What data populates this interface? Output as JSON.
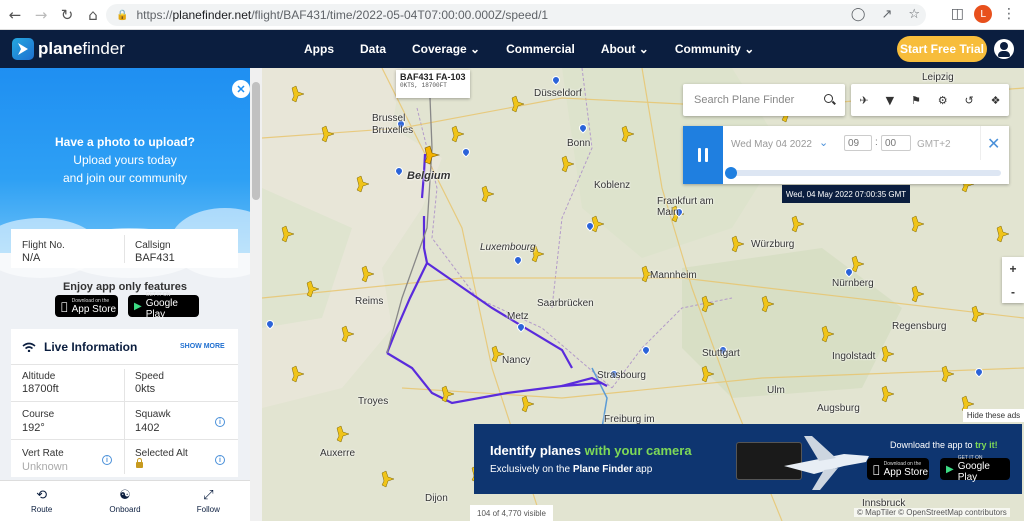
{
  "browser": {
    "url_prefix": "https://",
    "url_host": "planefinder.net",
    "url_path": "/flight/BAF431/time/2022-05-04T07:00:00.000Z/speed/1",
    "profile_initial": "L"
  },
  "header": {
    "logo_plane": "plane",
    "logo_finder": "finder",
    "nav": [
      "Apps",
      "Data",
      "Coverage ⌄",
      "Commercial",
      "About ⌄",
      "Community ⌄"
    ],
    "trial_button": "Start Free Trial"
  },
  "promo": {
    "title": "Have a photo to upload?",
    "line1": "Upload yours today",
    "line2": "and join our community",
    "close": "✕"
  },
  "flight": {
    "flight_no_label": "Flight No.",
    "flight_no_value": "N/A",
    "callsign_label": "Callsign",
    "callsign_value": "BAF431"
  },
  "app_features": {
    "heading": "Enjoy app only features",
    "app_store_small": "Download on the",
    "app_store": "App Store",
    "google_play_small": "GET IT ON",
    "google_play": "Google Play"
  },
  "live": {
    "heading": "Live Information",
    "show_more": "SHOW MORE",
    "altitude_label": "Altitude",
    "altitude_value": "18700ft",
    "speed_label": "Speed",
    "speed_value": "0kts",
    "course_label": "Course",
    "course_value": "192°",
    "squawk_label": "Squawk",
    "squawk_value": "1402",
    "vert_rate_label": "Vert Rate",
    "vert_rate_value": "Unknown",
    "selected_alt_label": "Selected Alt"
  },
  "bottom_tabs": {
    "route": "Route",
    "onboard": "Onboard",
    "follow": "Follow"
  },
  "map": {
    "search_placeholder": "Search Plane Finder",
    "date": "Wed May 04 2022",
    "hour": "09",
    "minute": "00",
    "timezone": "GMT+2",
    "time_tooltip": "Wed, 04 May 2022 07:00:35 GMT",
    "flight_label": "BAF431 FA-103",
    "flight_sub": "0KTS, 18700FT",
    "zoom_in": "+",
    "zoom_out": "-",
    "hide_ads": "Hide these ads",
    "visible_count": "104 of 4,770 visible",
    "attribution": "© MapTiler © OpenStreetMap contributors",
    "playback_progress": 0.0,
    "cities": [
      "Düsseldorf",
      "Brussel",
      "Bruxelles",
      "Belgium",
      "Bonn",
      "Koblenz",
      "Frankfurt am Main",
      "Luxembourg",
      "Würzburg",
      "Mannheim",
      "Saarbrücken",
      "Nürnberg",
      "Metz",
      "Reims",
      "Nancy",
      "Stuttgart",
      "Ingolstadt",
      "Regensburg",
      "Strasbourg",
      "Troyes",
      "Ulm",
      "Augsburg",
      "Freiburg im",
      "Auxerre",
      "Dijon",
      "Leipzig",
      "Innsbruck"
    ]
  },
  "ad": {
    "title_a": "Identify planes ",
    "title_b": "with your camera",
    "sub_a": "Exclusively on the ",
    "sub_b": "Plane Finder",
    "sub_c": " app",
    "dl_a": "Download the app to ",
    "dl_b": "try it!"
  },
  "colors": {
    "header_bg": "#0b1e3f",
    "accent": "#1f7fe0",
    "trial": "#f7bd3b",
    "flight_path": "#5a2bdc",
    "plane": "#f0c419"
  }
}
